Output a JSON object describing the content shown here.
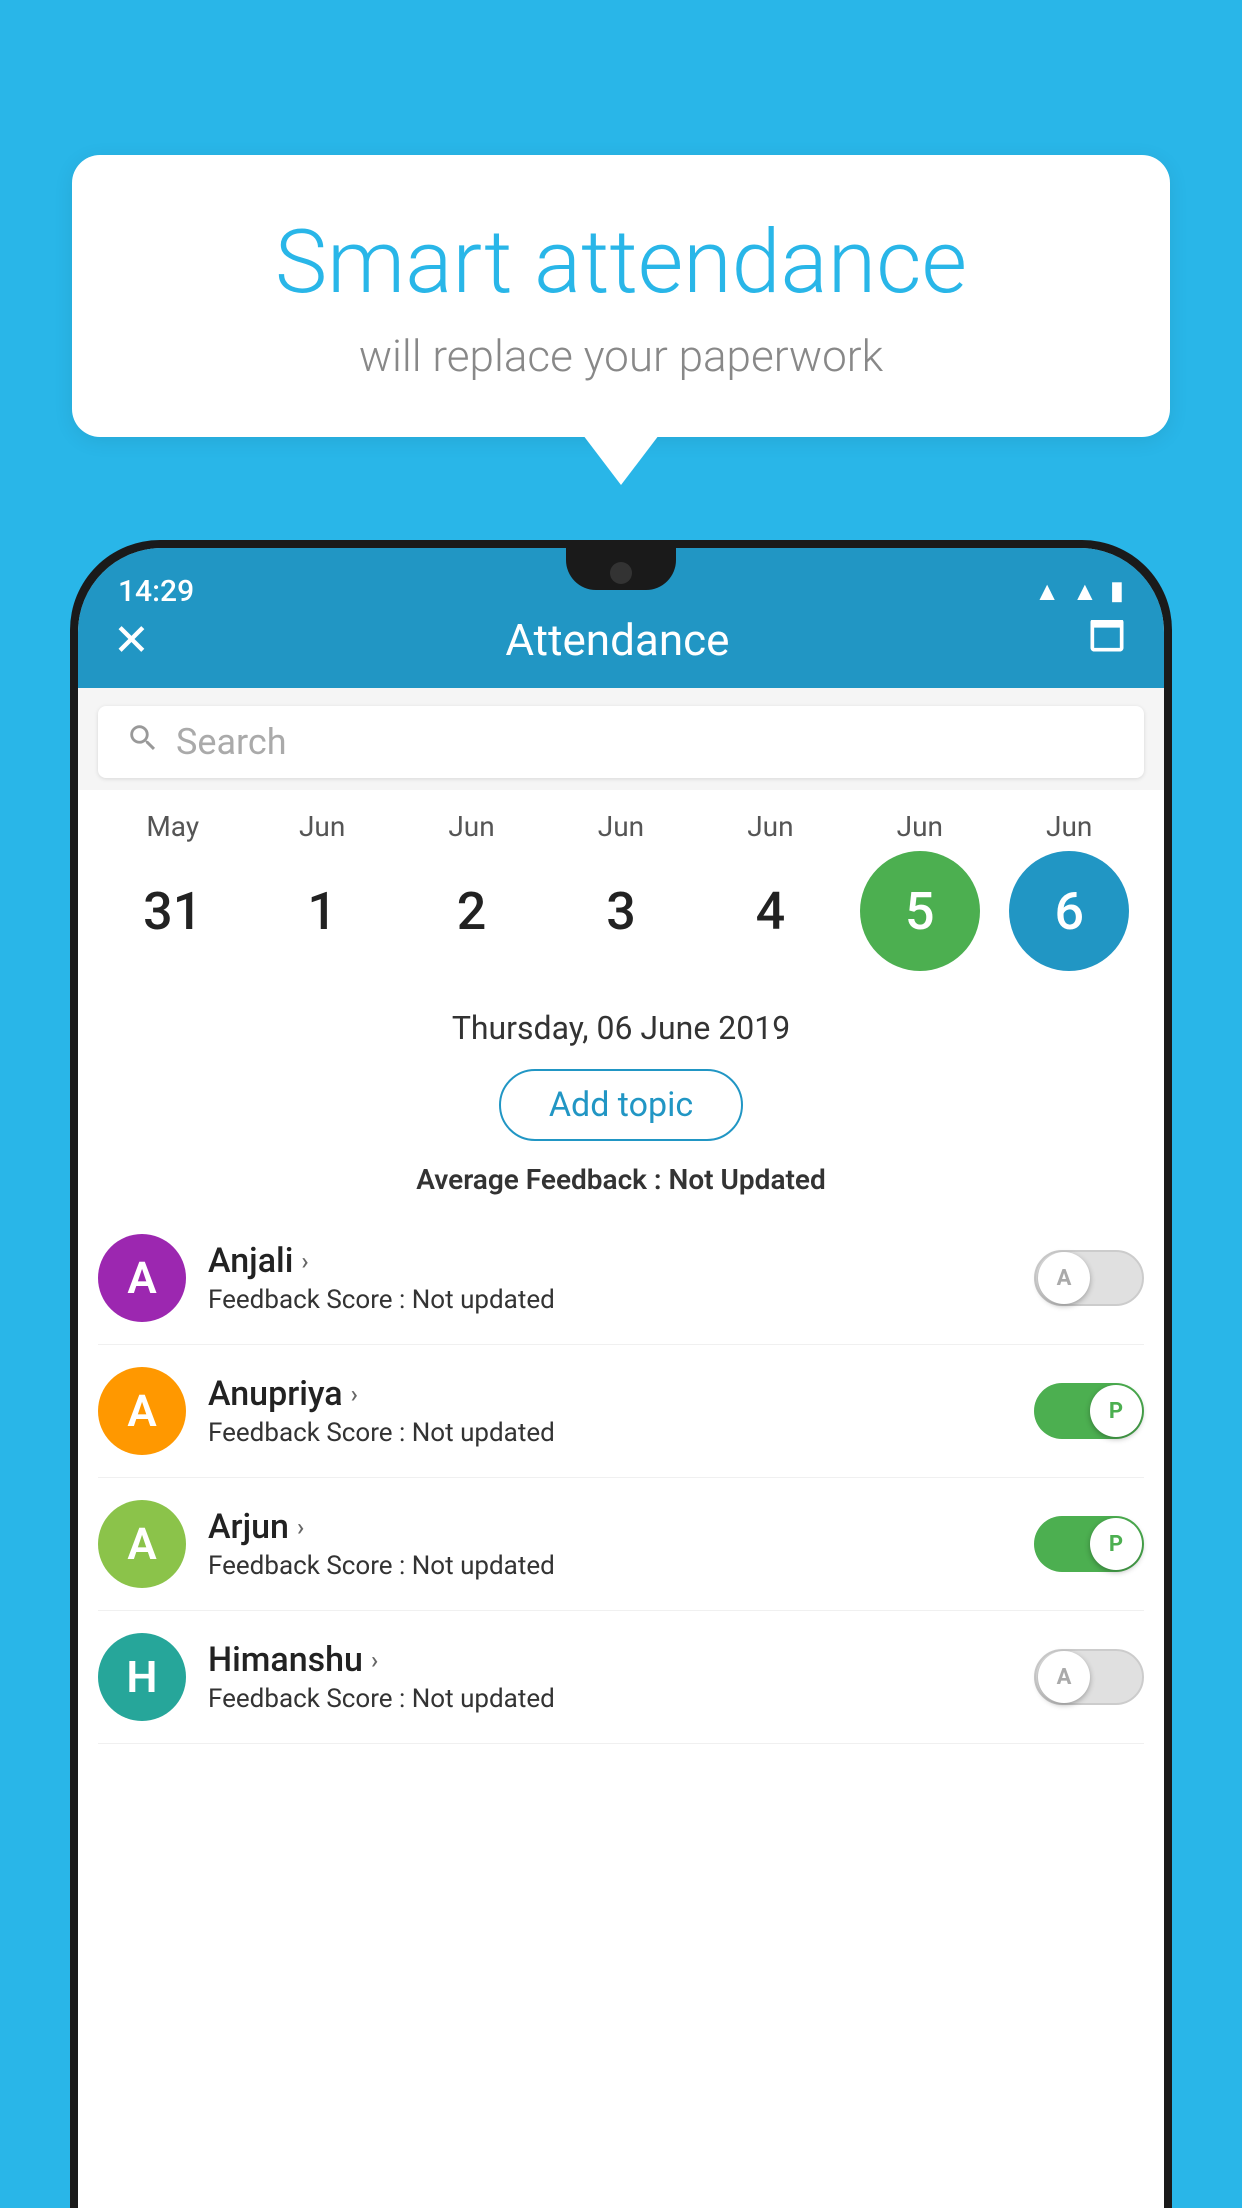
{
  "background": {
    "color": "#29b6e8"
  },
  "speech_bubble": {
    "title": "Smart attendance",
    "subtitle": "will replace your paperwork"
  },
  "status_bar": {
    "time": "14:29",
    "wifi_icon": "wifi",
    "signal_icon": "signal",
    "battery_icon": "battery"
  },
  "app_bar": {
    "close_icon": "✕",
    "title": "Attendance",
    "calendar_icon": "📅"
  },
  "search": {
    "placeholder": "Search"
  },
  "calendar": {
    "months": [
      "May",
      "Jun",
      "Jun",
      "Jun",
      "Jun",
      "Jun",
      "Jun"
    ],
    "dates": [
      "31",
      "1",
      "2",
      "3",
      "4",
      "5",
      "6"
    ],
    "today_index": 5,
    "selected_index": 6
  },
  "info": {
    "selected_date": "Thursday, 06 June 2019",
    "add_topic_label": "Add topic",
    "average_feedback_label": "Average Feedback : ",
    "average_feedback_value": "Not Updated"
  },
  "students": [
    {
      "name": "Anjali",
      "avatar_letter": "A",
      "avatar_color": "purple",
      "feedback_label": "Feedback Score : ",
      "feedback_value": "Not updated",
      "toggle_state": "off",
      "toggle_letter": "A"
    },
    {
      "name": "Anupriya",
      "avatar_letter": "A",
      "avatar_color": "orange",
      "feedback_label": "Feedback Score : ",
      "feedback_value": "Not updated",
      "toggle_state": "on",
      "toggle_letter": "P"
    },
    {
      "name": "Arjun",
      "avatar_letter": "A",
      "avatar_color": "green",
      "feedback_label": "Feedback Score : ",
      "feedback_value": "Not updated",
      "toggle_state": "on",
      "toggle_letter": "P"
    },
    {
      "name": "Himanshu",
      "avatar_letter": "H",
      "avatar_color": "teal",
      "feedback_label": "Feedback Score : ",
      "feedback_value": "Not updated",
      "toggle_state": "off",
      "toggle_letter": "A"
    }
  ]
}
